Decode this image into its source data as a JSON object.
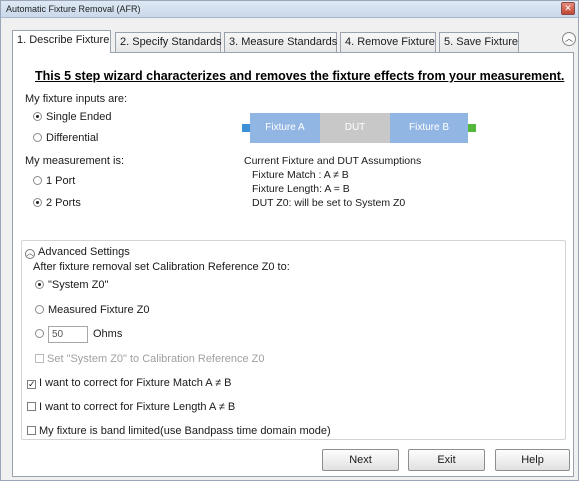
{
  "window": {
    "title": "Automatic Fixture Removal (AFR)"
  },
  "tabs": [
    {
      "label": "1. Describe Fixture",
      "active": true
    },
    {
      "label": "2. Specify Standards",
      "active": false
    },
    {
      "label": "3. Measure Standards",
      "active": false
    },
    {
      "label": "4. Remove Fixture",
      "active": false
    },
    {
      "label": "5. Save Fixture",
      "active": false
    }
  ],
  "headline": "This 5 step wizard characterizes and removes the fixture effects from your measurement.",
  "fixture_inputs": {
    "label": "My fixture inputs are:",
    "options": [
      {
        "label": "Single Ended",
        "selected": true
      },
      {
        "label": "Differential",
        "selected": false
      }
    ]
  },
  "measurement": {
    "label": "My measurement is:",
    "options": [
      {
        "label": "1 Port",
        "selected": false
      },
      {
        "label": "2 Ports",
        "selected": true
      }
    ]
  },
  "diagram": {
    "fixture_a": "Fixture A",
    "dut": "DUT",
    "fixture_b": "Fixture B",
    "colors": {
      "fixture": "#92b6e4",
      "dut": "#c8c8c8",
      "port_left": "#3d90d6",
      "port_right": "#53b83a"
    }
  },
  "assumptions": {
    "title": "Current Fixture and DUT Assumptions",
    "match": "Fixture Match : A ≠ B",
    "length": "Fixture Length: A = B",
    "dut_z0": "DUT Z0: will be set to System Z0"
  },
  "advanced": {
    "label": "Advanced Settings",
    "after_removal_label": "After fixture removal set Calibration Reference Z0 to:",
    "z0_options": [
      {
        "label": "\"System Z0\"",
        "selected": true
      },
      {
        "label": "Measured Fixture Z0",
        "selected": false
      },
      {
        "label": "Ohms",
        "selected": false,
        "value": "50"
      }
    ],
    "set_system_z0": {
      "label": "Set \"System Z0\" to Calibration Reference Z0",
      "checked": false,
      "enabled": false
    },
    "correct_match": {
      "label": "I want to correct for Fixture Match A ≠ B",
      "checked": true
    },
    "correct_length": {
      "label": "I want to correct for Fixture Length A ≠ B",
      "checked": false
    },
    "band_limited": {
      "label": "My fixture is band limited(use Bandpass time domain mode)",
      "checked": false
    }
  },
  "buttons": {
    "next": "Next",
    "exit": "Exit",
    "help": "Help"
  }
}
